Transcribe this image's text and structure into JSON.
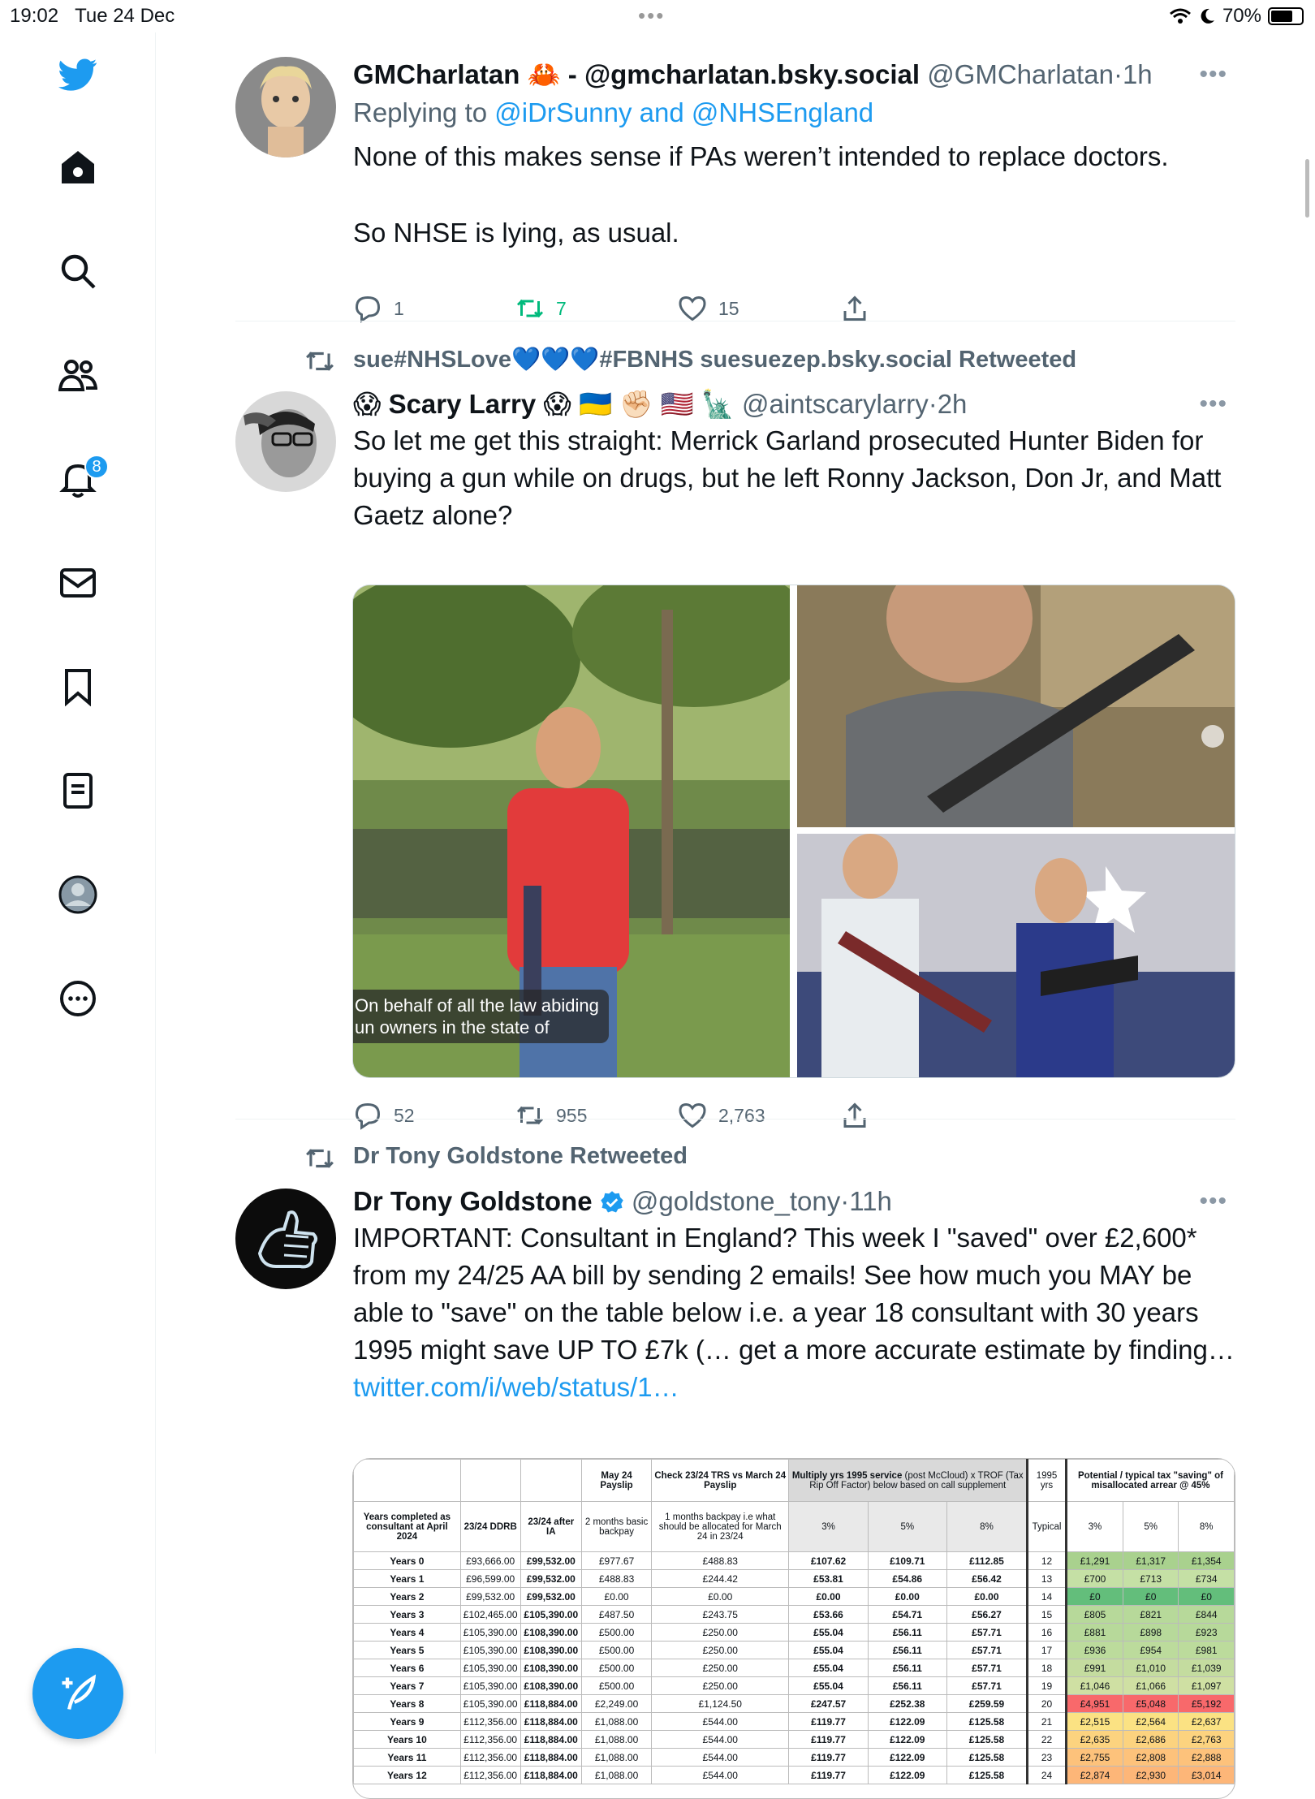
{
  "status_bar": {
    "time": "19:02",
    "date": "Tue 24 Dec",
    "battery": "70%"
  },
  "sidebar": {
    "notifications_badge": "8"
  },
  "tweets": [
    {
      "name": "GMCharlatan 🦀 - @gmcharlatan.bsky.social",
      "handle": "@GMCharlatan",
      "time": "1h",
      "replying_prefix": "Replying to ",
      "replying_to": "@iDrSunny and @NHSEngland",
      "text_1": "None of this makes sense if PAs weren’t intended to replace doctors.",
      "text_2": "So NHSE is lying, as usual.",
      "replies": "1",
      "retweets": "7",
      "likes": "15"
    },
    {
      "retweeted_by": "sue#NHSLove💙💙💙#FBNHS suesuezep.bsky.social Retweeted",
      "name": "😱 Scary Larry 😱 🇺🇦 ✊🏻 🇺🇸 🗽",
      "handle": "@aintscarylarry",
      "time": "2h",
      "text": "So let me get this straight: Merrick Garland prosecuted Hunter Biden for buying a gun while on drugs, but he left Ronny Jackson, Don Jr, and Matt Gaetz alone?",
      "video_caption_1": "On behalf of all the law abiding",
      "video_caption_2": "un owners in the state of",
      "replies": "52",
      "retweets": "955",
      "likes": "2,763"
    },
    {
      "retweeted_by": "Dr Tony Goldstone Retweeted",
      "name": "Dr Tony Goldstone",
      "handle": "@goldstone_tony",
      "time": "11h",
      "text": "IMPORTANT: Consultant in England? This week I \"saved\" over £2,600* from my 24/25 AA bill by sending 2 emails!  See how much you MAY be able to \"save\" on the table below i.e. a year 18 consultant with 30 years 1995 might save UP TO £7k (… get a more accurate estimate by finding…",
      "link": "twitter.com/i/web/status/1…"
    }
  ],
  "table": {
    "header_top": {
      "may_payslip": "May 24 Payslip",
      "check": "Check 23/24 TRS vs March 24 Payslip",
      "multiply_bold": "Multiply yrs 1995 service",
      "multiply_rest": " (post McCloud) x TROF (Tax Rip Off Factor) below based on call supplement",
      "yrs1995": "1995 yrs",
      "potential": "Potential / typical tax \"saving\" of misallocated arrear @ 45%"
    },
    "header_sub": [
      "Years completed as consultant at April 2024",
      "23/24 DDRB",
      "23/24 after IA",
      "2 months basic backpay",
      "1 months backpay i.e what should be allocated for March 24 in 23/24",
      "3%",
      "5%",
      "8%",
      "Typical",
      "3%",
      "5%",
      "8%"
    ],
    "rows": [
      [
        "Years 0",
        "£93,666.00",
        "£99,532.00",
        "£977.67",
        "£488.83",
        "£107.62",
        "£109.71",
        "£112.85",
        "12",
        "£1,291",
        "£1,317",
        "£1,354"
      ],
      [
        "Years 1",
        "£96,599.00",
        "£99,532.00",
        "£488.83",
        "£244.42",
        "£53.81",
        "£54.86",
        "£56.42",
        "13",
        "£700",
        "£713",
        "£734"
      ],
      [
        "Years 2",
        "£99,532.00",
        "£99,532.00",
        "£0.00",
        "£0.00",
        "£0.00",
        "£0.00",
        "£0.00",
        "14",
        "£0",
        "£0",
        "£0"
      ],
      [
        "Years 3",
        "£102,465.00",
        "£105,390.00",
        "£487.50",
        "£243.75",
        "£53.66",
        "£54.71",
        "£56.27",
        "15",
        "£805",
        "£821",
        "£844"
      ],
      [
        "Years 4",
        "£105,390.00",
        "£108,390.00",
        "£500.00",
        "£250.00",
        "£55.04",
        "£56.11",
        "£57.71",
        "16",
        "£881",
        "£898",
        "£923"
      ],
      [
        "Years 5",
        "£105,390.00",
        "£108,390.00",
        "£500.00",
        "£250.00",
        "£55.04",
        "£56.11",
        "£57.71",
        "17",
        "£936",
        "£954",
        "£981"
      ],
      [
        "Years 6",
        "£105,390.00",
        "£108,390.00",
        "£500.00",
        "£250.00",
        "£55.04",
        "£56.11",
        "£57.71",
        "18",
        "£991",
        "£1,010",
        "£1,039"
      ],
      [
        "Years 7",
        "£105,390.00",
        "£108,390.00",
        "£500.00",
        "£250.00",
        "£55.04",
        "£56.11",
        "£57.71",
        "19",
        "£1,046",
        "£1,066",
        "£1,097"
      ],
      [
        "Years 8",
        "£105,390.00",
        "£118,884.00",
        "£2,249.00",
        "£1,124.50",
        "£247.57",
        "£252.38",
        "£259.59",
        "20",
        "£4,951",
        "£5,048",
        "£5,192"
      ],
      [
        "Years 9",
        "£112,356.00",
        "£118,884.00",
        "£1,088.00",
        "£544.00",
        "£119.77",
        "£122.09",
        "£125.58",
        "21",
        "£2,515",
        "£2,564",
        "£2,637"
      ],
      [
        "Years 10",
        "£112,356.00",
        "£118,884.00",
        "£1,088.00",
        "£544.00",
        "£119.77",
        "£122.09",
        "£125.58",
        "22",
        "£2,635",
        "£2,686",
        "£2,763"
      ],
      [
        "Years 11",
        "£112,356.00",
        "£118,884.00",
        "£1,088.00",
        "£544.00",
        "£119.77",
        "£122.09",
        "£125.58",
        "23",
        "£2,755",
        "£2,808",
        "£2,888"
      ],
      [
        "Years 12",
        "£112,356.00",
        "£118,884.00",
        "£1,088.00",
        "£544.00",
        "£119.77",
        "£122.09",
        "£125.58",
        "24",
        "£2,874",
        "£2,930",
        "£3,014"
      ]
    ],
    "row_colors": [
      "#a9d18e",
      "#c5e0a5",
      "#63be7b",
      "#b7d99a",
      "#b7d99a",
      "#bcdb9c",
      "#c4dc9f",
      "#cfe0a3",
      "#f8696b",
      "#fbe283",
      "#fcd37f",
      "#fdc27b",
      "#fdb678"
    ]
  }
}
